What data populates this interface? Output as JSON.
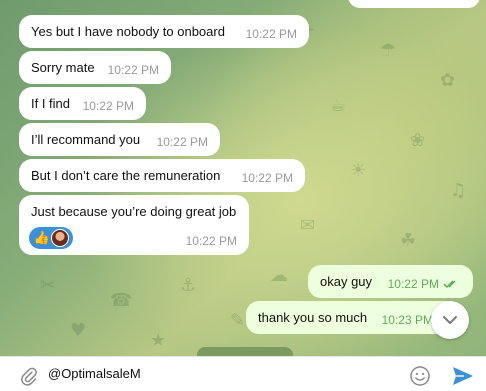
{
  "messages": [
    {
      "text": "Yes but I have nobody to onboard",
      "time": "10:22 PM",
      "direction": "in"
    },
    {
      "text": "Sorry mate",
      "time": "10:22 PM",
      "direction": "in"
    },
    {
      "text": "If I find",
      "time": "10:22 PM",
      "direction": "in"
    },
    {
      "text": "I’ll recommand you",
      "time": "10:22 PM",
      "direction": "in"
    },
    {
      "text": "But I don’t care the remuneration",
      "time": "10:22 PM",
      "direction": "in"
    },
    {
      "text": "Just because you’re doing great job",
      "time": "10:22 PM",
      "direction": "in",
      "reactions": [
        "thumbs-up-emoji",
        "user-avatar"
      ]
    },
    {
      "text": "okay guy",
      "time": "10:22 PM",
      "direction": "out",
      "status": "read"
    },
    {
      "text": "thank you so much",
      "time": "10:23 PM",
      "direction": "out"
    }
  ],
  "reaction_emoji": "👍",
  "composer": {
    "value": "@OptimalsaleM"
  },
  "icons": {
    "attach": "paperclip-icon",
    "emoji": "smiley-icon",
    "send": "send-icon",
    "scroll": "chevron-down-icon"
  },
  "colors": {
    "incoming_bubble": "#ffffff",
    "outgoing_bubble": "#eeffde",
    "outgoing_time": "#5fae5a",
    "send_accent": "#3a90d9",
    "reaction_pill": "#3a90d9"
  }
}
